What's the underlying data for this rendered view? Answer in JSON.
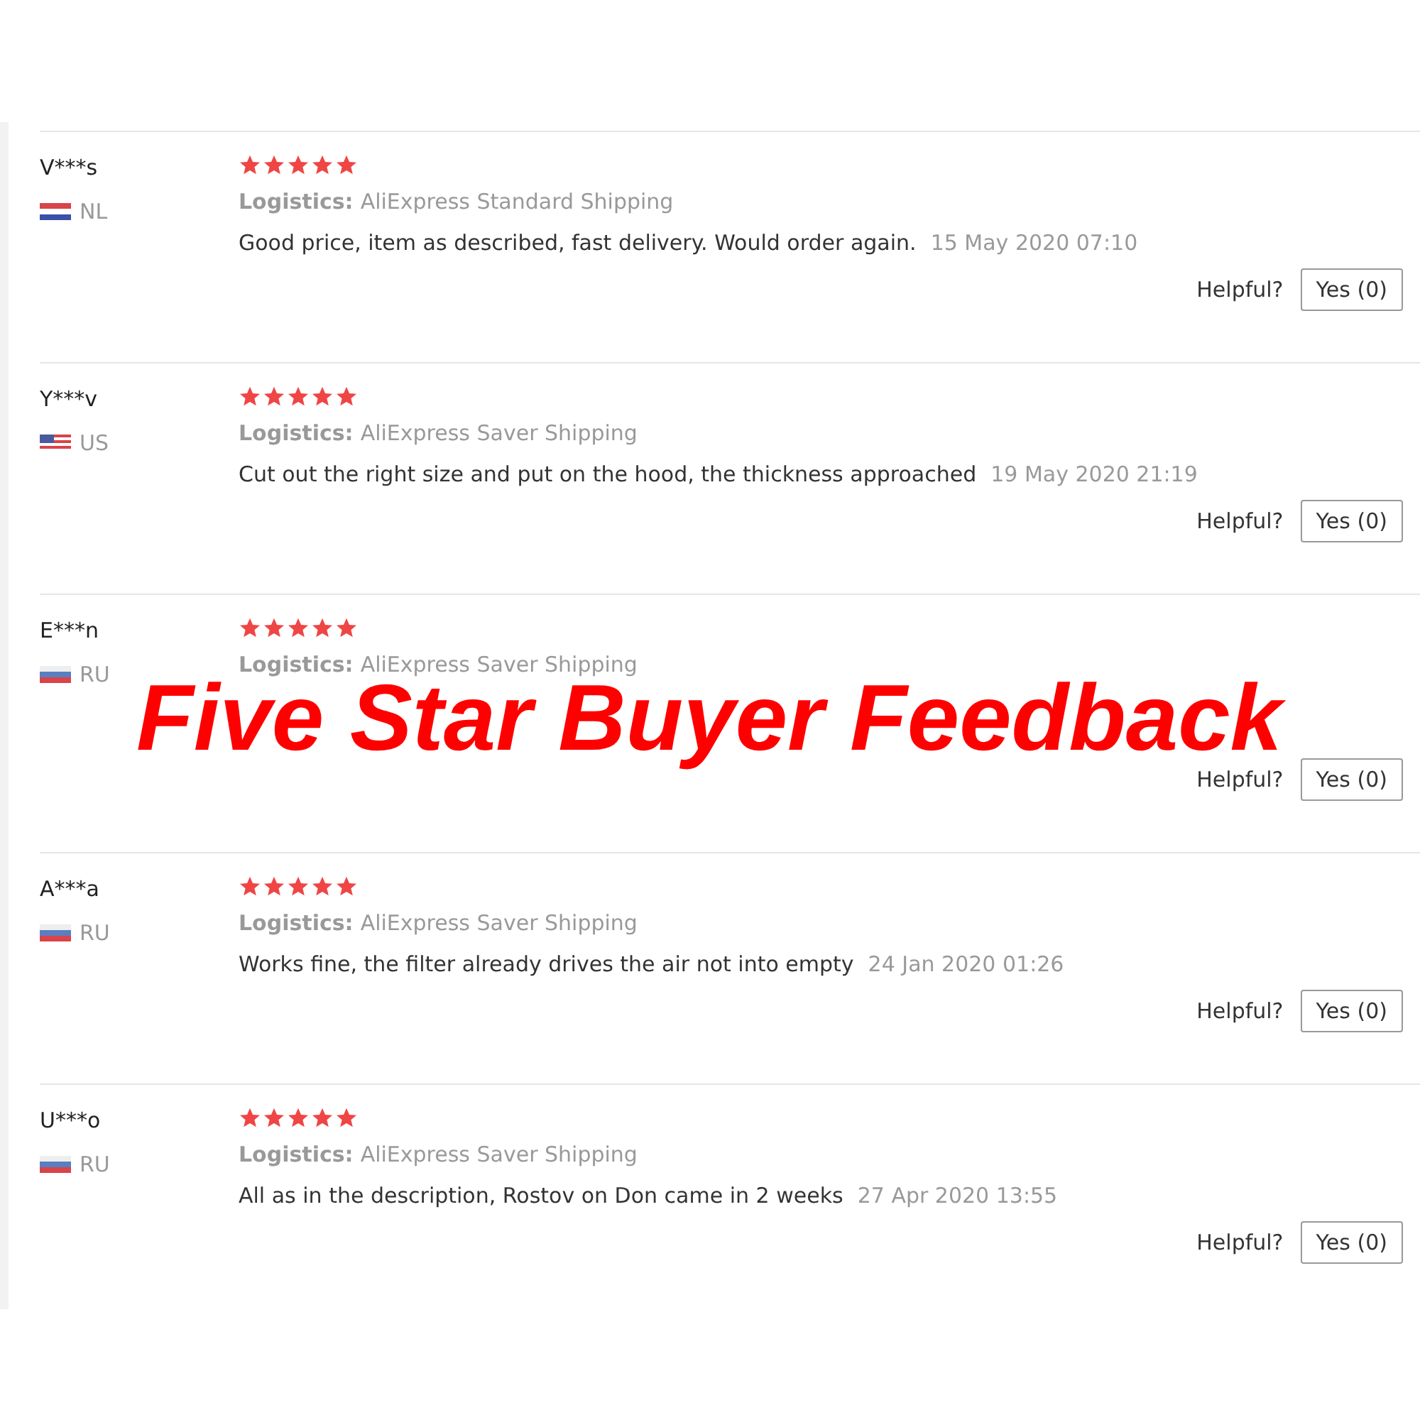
{
  "headline": "Five Star Buyer Feedback",
  "reviews": [
    {
      "buyer": "V***s",
      "kind": "nl",
      "country": "NL",
      "stars": 5,
      "logistics_label": "Logistics:",
      "logistics": "AliExpress Standard Shipping",
      "comment": "Good price, item as described, fast delivery. Would order again.",
      "date": "15 May 2020 07:10",
      "helpful_label": "Helpful?",
      "vote_button": "Yes (0)"
    },
    {
      "buyer": "Y***v",
      "kind": "us",
      "country": "US",
      "stars": 5,
      "logistics_label": "Logistics:",
      "logistics": "AliExpress Saver Shipping",
      "comment": "Cut out the right size and put on the hood, the thickness approached",
      "date": "19 May 2020 21:19",
      "helpful_label": "Helpful?",
      "vote_button": "Yes (0)"
    },
    {
      "buyer": "E***n",
      "kind": "ru",
      "country": "RU",
      "stars": 5,
      "logistics_label": "Logistics:",
      "logistics": "AliExpress Saver Shipping",
      "helpful_label": "Helpful?",
      "vote_button": "Yes (0)"
    },
    {
      "buyer": "A***a",
      "kind": "ru",
      "country": "RU",
      "stars": 5,
      "logistics_label": "Logistics:",
      "logistics": "AliExpress Saver Shipping",
      "comment": "Works fine, the filter already drives the air not into empty",
      "date": "24 Jan 2020 01:26",
      "helpful_label": "Helpful?",
      "vote_button": "Yes (0)"
    },
    {
      "buyer": "U***o",
      "kind": "ru",
      "country": "RU",
      "stars": 5,
      "logistics_label": "Logistics:",
      "logistics": "AliExpress Saver Shipping",
      "comment": "All as in the description, Rostov on Don came in 2 weeks",
      "date": "27 Apr 2020 13:55",
      "helpful_label": "Helpful?",
      "vote_button": "Yes (0)"
    }
  ]
}
